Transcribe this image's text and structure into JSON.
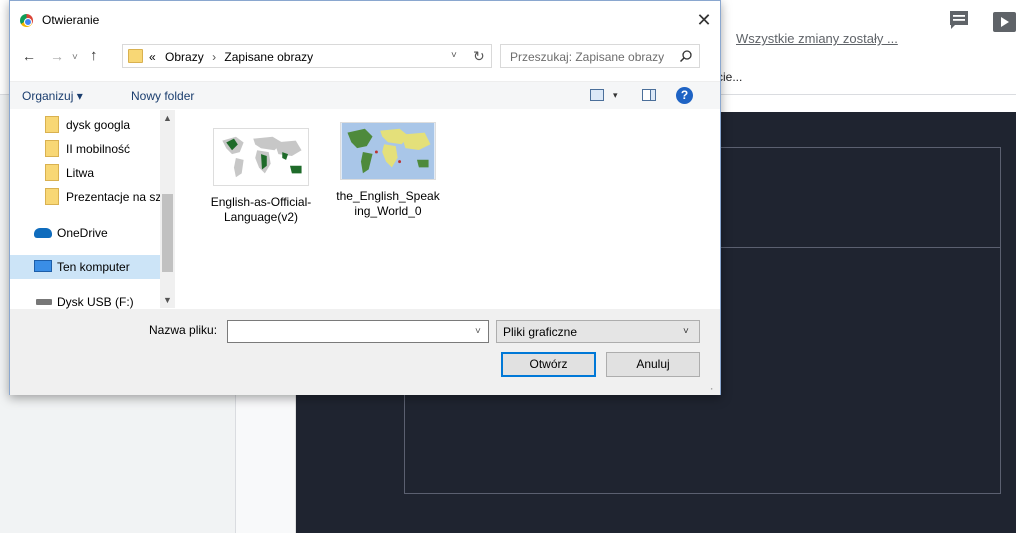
{
  "background": {
    "save_status": "Wszystkie zmiany zostały ...",
    "menu_fragment": "cie...",
    "comment_icon": "comment-icon",
    "present_icon": "present-icon"
  },
  "dialog": {
    "title": "Otwieranie",
    "close_glyph": "✕",
    "nav": {
      "back": "←",
      "forward": "→",
      "history": "˅",
      "up": "↑"
    },
    "address": {
      "prefix": "«",
      "crumbs": [
        "Obrazy",
        "Zapisane obrazy"
      ],
      "separator": "›",
      "dropdown": "˅",
      "refresh": "↻"
    },
    "search": {
      "placeholder": "Przeszukaj: Zapisane obrazy"
    },
    "toolbar": {
      "organize": "Organizuj ▾",
      "new_folder": "Nowy folder",
      "view_arrow": "▾",
      "help": "?"
    },
    "nav_pane": {
      "items": [
        {
          "label": "dysk googla",
          "type": "folder"
        },
        {
          "label": "II mobilność",
          "type": "folder"
        },
        {
          "label": "Litwa",
          "type": "folder"
        },
        {
          "label": "Prezentacje na szkolenie",
          "type": "folder"
        },
        {
          "label": "OneDrive",
          "type": "onedrive"
        },
        {
          "label": "Ten komputer",
          "type": "pc",
          "selected": true
        },
        {
          "label": "Dysk USB (F:)",
          "type": "usb"
        }
      ],
      "scroll_up": "▲",
      "scroll_down": "▼"
    },
    "files": [
      {
        "name": "English-as-Official-Language(v2)"
      },
      {
        "name": "the_English_Speaking_World_0"
      }
    ],
    "bottom": {
      "filename_label": "Nazwa pliku:",
      "filename_value": "",
      "filename_dropdown": "˅",
      "filter_value": "Pliki graficzne",
      "filter_arrow": "˅",
      "open_label": "Otwórz",
      "cancel_label": "Anuluj",
      "grip": "⠠"
    }
  }
}
